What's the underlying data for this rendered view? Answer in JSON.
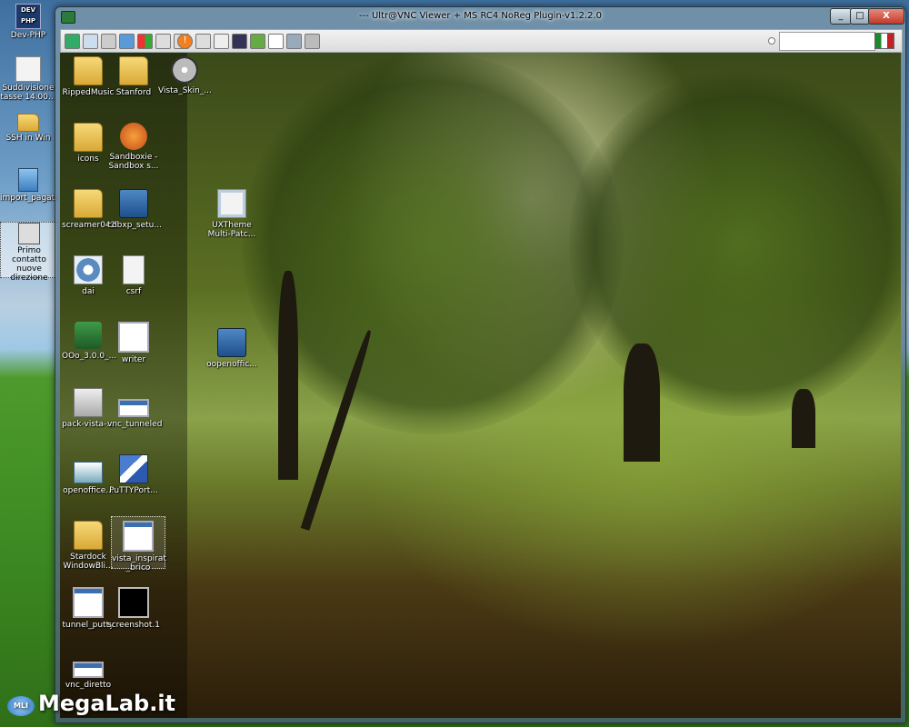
{
  "desktop": {
    "icons": [
      {
        "label": "Dev-PHP",
        "badge": "DEV PHP"
      },
      {
        "label": "Suddivisione tasse 14.00..."
      },
      {
        "label": "SSH in Win"
      },
      {
        "label": "import_pagati"
      },
      {
        "label": "Primo contatto nuove direzione"
      }
    ]
  },
  "window": {
    "title": "--- Ultr@VNC Viewer + MS RC4 NoReg Plugin-v1.2.2.0",
    "minimize_label": "_",
    "maximize_label": "□",
    "close_label": "X"
  },
  "remote": {
    "icons": [
      {
        "label": "RippedMusic"
      },
      {
        "label": "Stanford"
      },
      {
        "label": "Vista_Skin_..."
      },
      {
        "label": "icons"
      },
      {
        "label": "Sandboxie - Sandbox s..."
      },
      {
        "label": "screamer042"
      },
      {
        "label": "cdbxp_setu..."
      },
      {
        "label": "UXTheme Multi-Patc..."
      },
      {
        "label": "dai"
      },
      {
        "label": "csrf"
      },
      {
        "label": "OOo_3.0.0_..."
      },
      {
        "label": "writer"
      },
      {
        "label": "oopenoffic..."
      },
      {
        "label": "pack-vista-..."
      },
      {
        "label": "vnc_tunneled"
      },
      {
        "label": "openoffice..."
      },
      {
        "label": "PuTTYPort..."
      },
      {
        "label": "Stardock WindowBli..."
      },
      {
        "label": "vista_inspirat _brico"
      },
      {
        "label": "tunnel_putty"
      },
      {
        "label": "screenshot.1"
      },
      {
        "label": "vnc_diretto"
      }
    ]
  },
  "watermark": {
    "logo": "MLI",
    "text": "MegaLab.it"
  },
  "colors": {
    "accent": "#3b6fb0",
    "folder": "#f7d978"
  }
}
